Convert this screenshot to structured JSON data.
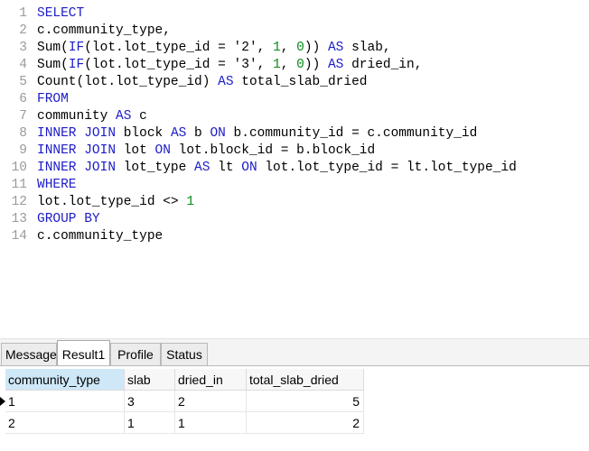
{
  "editor": {
    "lines": [
      {
        "n": "1",
        "tokens": [
          {
            "t": "SELECT",
            "c": "kw"
          }
        ]
      },
      {
        "n": "2",
        "tokens": [
          {
            "t": "c.community_type,",
            "c": ""
          }
        ]
      },
      {
        "n": "3",
        "tokens": [
          {
            "t": "Sum(",
            "c": ""
          },
          {
            "t": "IF",
            "c": "kw"
          },
          {
            "t": "(lot.lot_type_id = ",
            "c": ""
          },
          {
            "t": "'2'",
            "c": "str"
          },
          {
            "t": ", ",
            "c": ""
          },
          {
            "t": "1",
            "c": "num"
          },
          {
            "t": ", ",
            "c": ""
          },
          {
            "t": "0",
            "c": "num"
          },
          {
            "t": ")) ",
            "c": ""
          },
          {
            "t": "AS",
            "c": "kw"
          },
          {
            "t": " slab,",
            "c": ""
          }
        ]
      },
      {
        "n": "4",
        "tokens": [
          {
            "t": "Sum(",
            "c": ""
          },
          {
            "t": "IF",
            "c": "kw"
          },
          {
            "t": "(lot.lot_type_id = ",
            "c": ""
          },
          {
            "t": "'3'",
            "c": "str"
          },
          {
            "t": ", ",
            "c": ""
          },
          {
            "t": "1",
            "c": "num"
          },
          {
            "t": ", ",
            "c": ""
          },
          {
            "t": "0",
            "c": "num"
          },
          {
            "t": ")) ",
            "c": ""
          },
          {
            "t": "AS",
            "c": "kw"
          },
          {
            "t": " dried_in,",
            "c": ""
          }
        ]
      },
      {
        "n": "5",
        "tokens": [
          {
            "t": "Count(lot.lot_type_id) ",
            "c": ""
          },
          {
            "t": "AS",
            "c": "kw"
          },
          {
            "t": " total_slab_dried",
            "c": ""
          }
        ]
      },
      {
        "n": "6",
        "tokens": [
          {
            "t": "FROM",
            "c": "kw"
          }
        ]
      },
      {
        "n": "7",
        "tokens": [
          {
            "t": "community ",
            "c": ""
          },
          {
            "t": "AS",
            "c": "kw"
          },
          {
            "t": " c",
            "c": ""
          }
        ]
      },
      {
        "n": "8",
        "tokens": [
          {
            "t": "INNER JOIN",
            "c": "kw"
          },
          {
            "t": " block ",
            "c": ""
          },
          {
            "t": "AS",
            "c": "kw"
          },
          {
            "t": " b ",
            "c": ""
          },
          {
            "t": "ON",
            "c": "kw"
          },
          {
            "t": " b.community_id = c.community_id",
            "c": ""
          }
        ]
      },
      {
        "n": "9",
        "tokens": [
          {
            "t": "INNER JOIN",
            "c": "kw"
          },
          {
            "t": " lot ",
            "c": ""
          },
          {
            "t": "ON",
            "c": "kw"
          },
          {
            "t": " lot.block_id = b.block_id",
            "c": ""
          }
        ]
      },
      {
        "n": "10",
        "tokens": [
          {
            "t": "INNER JOIN",
            "c": "kw"
          },
          {
            "t": " lot_type ",
            "c": ""
          },
          {
            "t": "AS",
            "c": "kw"
          },
          {
            "t": " lt ",
            "c": ""
          },
          {
            "t": "ON",
            "c": "kw"
          },
          {
            "t": " lot.lot_type_id = lt.lot_type_id",
            "c": ""
          }
        ]
      },
      {
        "n": "11",
        "tokens": [
          {
            "t": "WHERE",
            "c": "kw"
          }
        ]
      },
      {
        "n": "12",
        "tokens": [
          {
            "t": "lot.lot_type_id <> ",
            "c": ""
          },
          {
            "t": "1",
            "c": "num"
          }
        ]
      },
      {
        "n": "13",
        "tokens": [
          {
            "t": "GROUP BY",
            "c": "kw"
          }
        ]
      },
      {
        "n": "14",
        "tokens": [
          {
            "t": "c.community_type",
            "c": ""
          }
        ]
      }
    ]
  },
  "tabs": [
    {
      "label": "Message",
      "active": false
    },
    {
      "label": "Result1",
      "active": true
    },
    {
      "label": "Profile",
      "active": false
    },
    {
      "label": "Status",
      "active": false
    }
  ],
  "results": {
    "columns": [
      "community_type",
      "slab",
      "dried_in",
      "total_slab_dried"
    ],
    "rows": [
      [
        "1",
        "3",
        "2",
        "5"
      ],
      [
        "2",
        "1",
        "1",
        "2"
      ]
    ],
    "current_row": 0
  },
  "colors": {
    "keyword": "#1c1cc8",
    "number": "#0a8a1a",
    "selected_header": "#cfe8f8"
  }
}
